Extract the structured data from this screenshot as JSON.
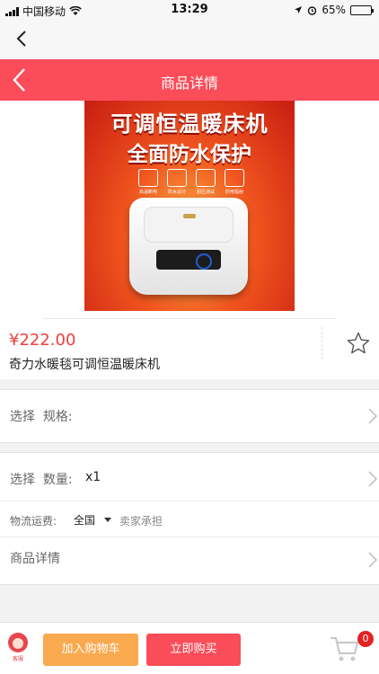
{
  "status_bar": {
    "carrier": "中国移动",
    "time": "13:29",
    "battery_percent": "65%",
    "battery_level": 0.65
  },
  "header": {
    "title": "商品详情"
  },
  "product": {
    "banner_line1": "可调恒温暖床机",
    "banner_line2": "全面防水保护",
    "features": [
      "高温断电",
      "防水设计",
      "耐压测试",
      "防电辐射"
    ],
    "price": "¥222.00",
    "name": "奇力水暖毯可调恒温暖床机"
  },
  "options": {
    "spec_prefix": "选择",
    "spec_label": "规格:",
    "qty_prefix": "选择",
    "qty_label": "数量:",
    "qty_value": "x1",
    "shipping_label": "物流运费:",
    "shipping_region": "全国",
    "shipping_note": "卖家承担",
    "detail_label": "商品详情"
  },
  "bottom_bar": {
    "service_tag": "客服",
    "add_to_cart": "加入购物车",
    "buy_now": "立即购买",
    "cart_count": "0"
  },
  "colors": {
    "accent_red": "#fa4d59",
    "price_red": "#f23c3c",
    "cart_orange": "#f9a94e"
  }
}
